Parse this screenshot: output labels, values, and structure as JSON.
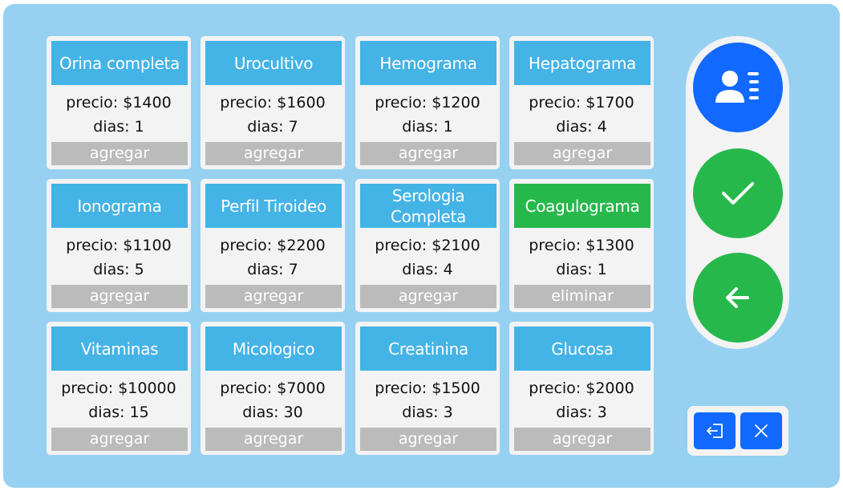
{
  "colors": {
    "background": "#96d1f2",
    "panel": "#f3f3f3",
    "title_bar": "#44b3e6",
    "selected_title_bar": "#27b84c",
    "action_bar": "#bbbbbb",
    "primary_blue": "#1169ff",
    "confirm_green": "#27b84c"
  },
  "tests": [
    {
      "name": "Orina completa",
      "price": "precio: $1400",
      "days": "dias: 1",
      "action": "agregar",
      "selected": false
    },
    {
      "name": "Urocultivo",
      "price": "precio: $1600",
      "days": "dias: 7",
      "action": "agregar",
      "selected": false
    },
    {
      "name": "Hemograma",
      "price": "precio: $1200",
      "days": "dias: 1",
      "action": "agregar",
      "selected": false
    },
    {
      "name": "Hepatograma",
      "price": "precio: $1700",
      "days": "dias: 4",
      "action": "agregar",
      "selected": false
    },
    {
      "name": "Ionograma",
      "price": "precio: $1100",
      "days": "dias: 5",
      "action": "agregar",
      "selected": false
    },
    {
      "name": "Perfil Tiroideo",
      "price": "precio: $2200",
      "days": "dias: 7",
      "action": "agregar",
      "selected": false
    },
    {
      "name": "Serologia Completa",
      "price": "precio: $2100",
      "days": "dias: 4",
      "action": "agregar",
      "selected": false
    },
    {
      "name": "Coagulograma",
      "price": "precio: $1300",
      "days": "dias: 1",
      "action": "eliminar",
      "selected": true
    },
    {
      "name": "Vitaminas",
      "price": "precio: $10000",
      "days": "dias: 15",
      "action": "agregar",
      "selected": false
    },
    {
      "name": "Micologico",
      "price": "precio: $7000",
      "days": "dias: 30",
      "action": "agregar",
      "selected": false
    },
    {
      "name": "Creatinina",
      "price": "precio: $1500",
      "days": "dias: 3",
      "action": "agregar",
      "selected": false
    },
    {
      "name": "Glucosa",
      "price": "precio: $2000",
      "days": "dias: 3",
      "action": "agregar",
      "selected": false
    }
  ],
  "side_actions": {
    "patient_icon": "patient-card-icon",
    "confirm_icon": "checkmark-icon",
    "back_icon": "arrow-left-icon"
  },
  "bottom_actions": {
    "logout_icon": "logout-icon",
    "close_icon": "close-icon"
  }
}
